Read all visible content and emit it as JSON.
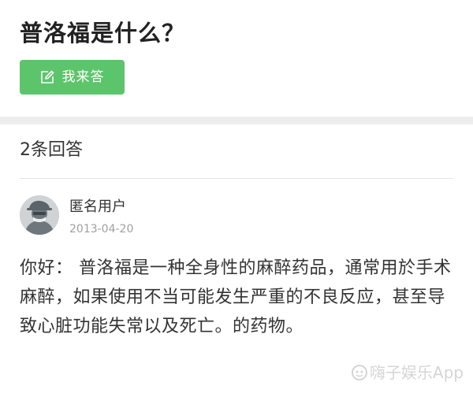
{
  "question": {
    "title": "普洛福是什么？",
    "answer_button_label": "我来答",
    "answer_button_color": "#5cc56c"
  },
  "answers": {
    "count_label": "2条回答",
    "items": [
      {
        "user_name": "匿名用户",
        "date": "2013-04-20",
        "avatar_icon": "anonymous-user-icon",
        "content": "你好：  普洛福是一种全身性的麻醉药品，通常用於手术麻醉，如果使用不当可能发生严重的不良反应，甚至导致心脏功能失常以及死亡。的药物。"
      }
    ]
  },
  "watermark": {
    "text": "嗨子娱乐App",
    "logo_icon": "watermark-logo-icon"
  }
}
